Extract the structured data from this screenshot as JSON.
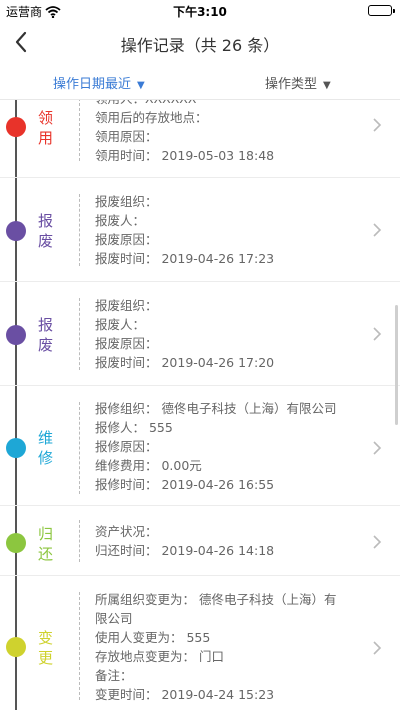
{
  "status_bar": {
    "carrier": "运营商",
    "time": "下午3:10"
  },
  "nav": {
    "title": "操作记录（共 26 条）"
  },
  "filters": {
    "date_label": "操作日期最近",
    "type_label": "操作类型",
    "arrow": "▼"
  },
  "colors": {
    "accent": "#3a7bd5",
    "lingyong": "#e8332a",
    "baofei": "#6a4fa3",
    "weixiu": "#1ea7d6",
    "guihuan": "#8cc63f",
    "biangeng": "#cfd22e"
  },
  "records": [
    {
      "type": "领用",
      "color": "#e8332a",
      "fields": [
        "领用人：XXXXXX",
        "领用后的存放地点：",
        "领用原因：",
        "领用时间：  2019-05-03 18:48"
      ]
    },
    {
      "type": "报废",
      "color": "#6a4fa3",
      "fields": [
        "报废组织：",
        "报废人：",
        "报废原因：",
        "报废时间：  2019-04-26 17:23"
      ]
    },
    {
      "type": "报废",
      "color": "#6a4fa3",
      "fields": [
        "报废组织：",
        "报废人：",
        "报废原因：",
        "报废时间：  2019-04-26 17:20"
      ]
    },
    {
      "type": "维修",
      "color": "#1ea7d6",
      "fields": [
        "报修组织：  德佟电子科技（上海）有限公司",
        "报修人：  555",
        "报修原因：",
        "维修费用：  0.00元",
        "报修时间：  2019-04-26 16:55"
      ]
    },
    {
      "type": "归还",
      "color": "#8cc63f",
      "fields": [
        "资产状况：",
        "归还时间：  2019-04-26 14:18"
      ]
    },
    {
      "type": "变更",
      "color": "#cfd22e",
      "fields": [
        "所属组织变更为：  德佟电子科技（上海）有限公司",
        "使用人变更为：  555",
        "存放地点变更为：  门口",
        "备注：",
        "变更时间：  2019-04-24 15:23"
      ]
    }
  ]
}
